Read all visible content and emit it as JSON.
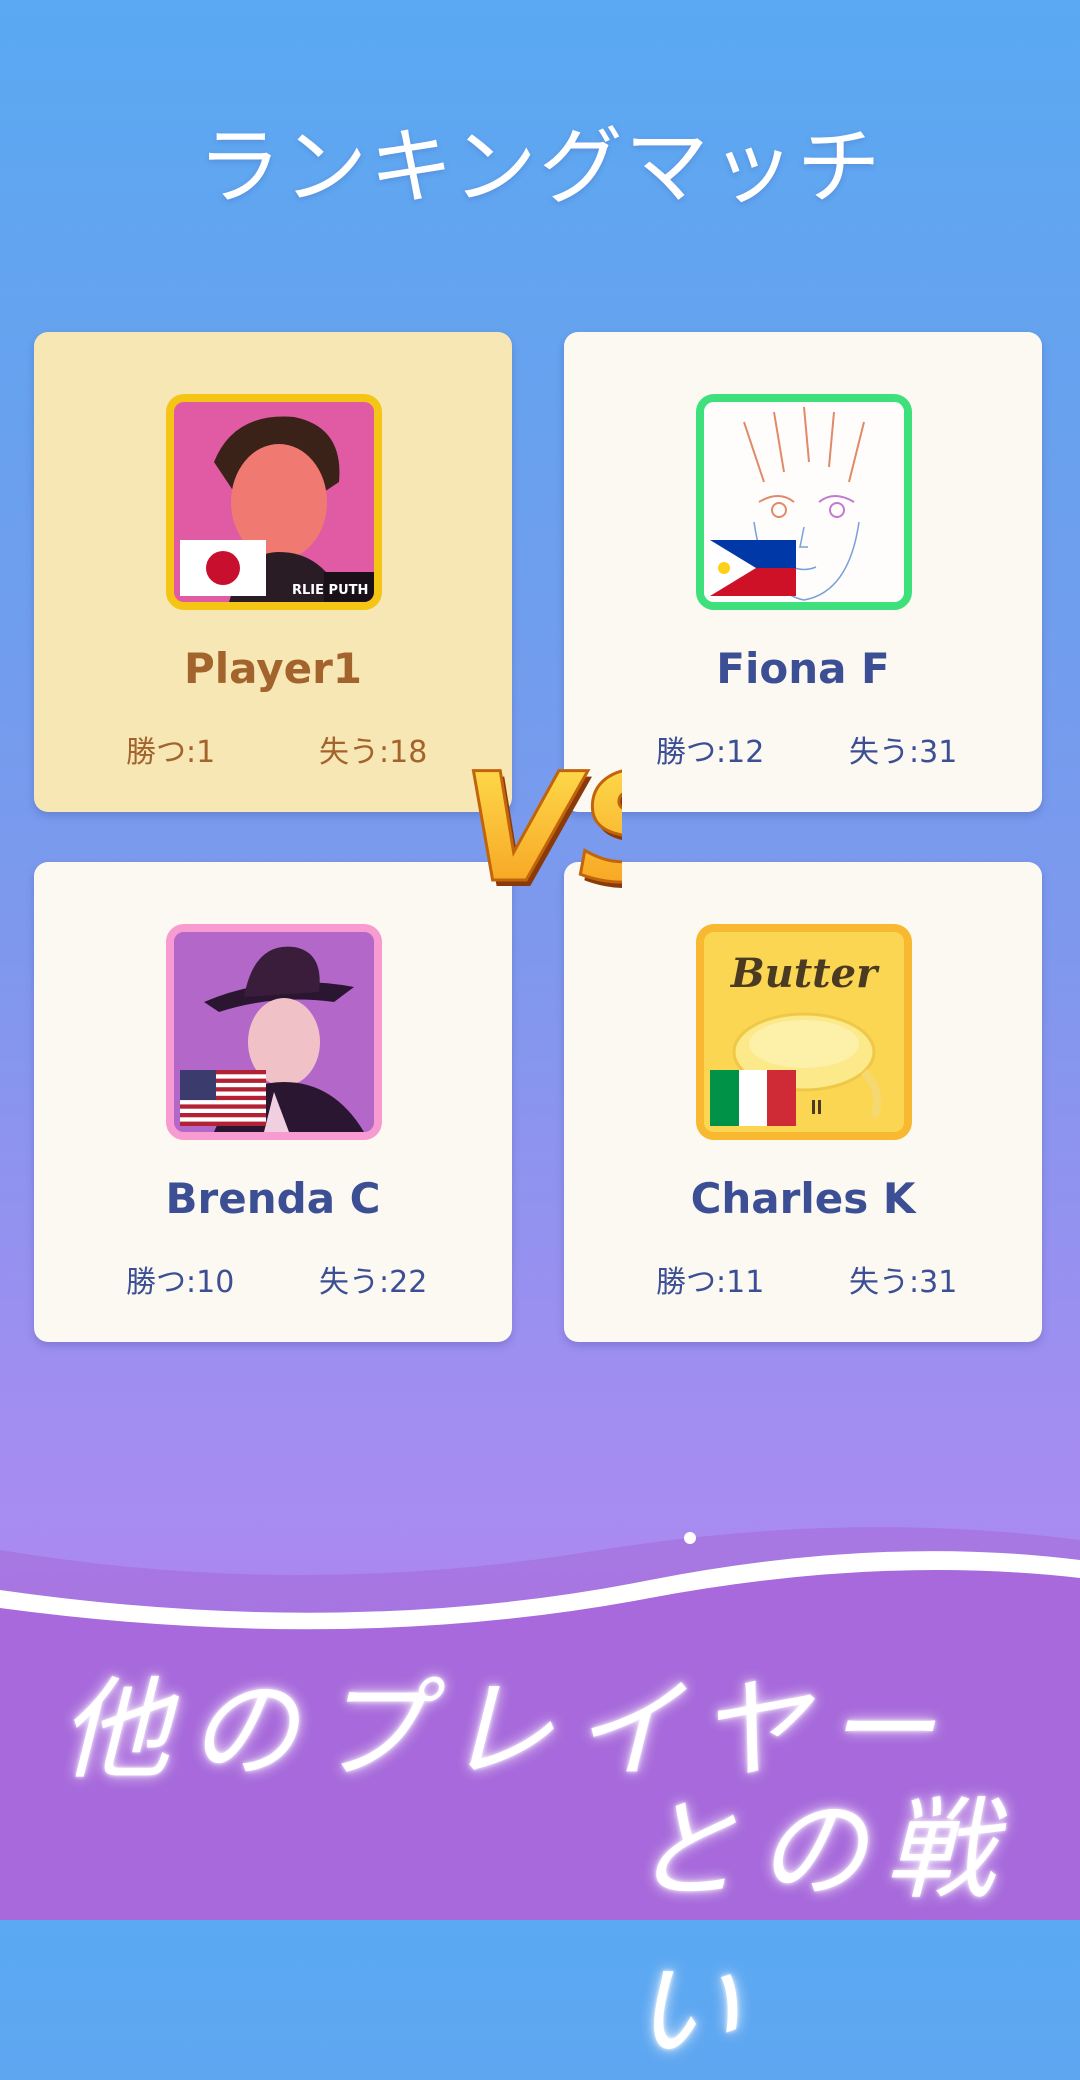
{
  "title": "ランキングマッチ",
  "players": [
    {
      "name": "Player1",
      "win_label": "勝つ:1",
      "loss_label": "失う:18",
      "flag": "japan-flag",
      "frame_color": "#f5c516",
      "highlight": true
    },
    {
      "name": "Fiona F",
      "win_label": "勝つ:12",
      "loss_label": "失う:31",
      "flag": "philippines-flag",
      "frame_color": "#3de07a",
      "highlight": false
    },
    {
      "name": "Brenda C",
      "win_label": "勝つ:10",
      "loss_label": "失う:22",
      "flag": "usa-flag",
      "frame_color": "#f79bd0",
      "highlight": false
    },
    {
      "name": "Charles K",
      "win_label": "勝つ:11",
      "loss_label": "失う:31",
      "flag": "italy-flag",
      "frame_color": "#f8b830",
      "highlight": false
    }
  ],
  "album_text": {
    "player1": "RLIE PUTH",
    "charles": "Butter"
  },
  "vs_label": "VS",
  "tagline": {
    "line1": "他のプレイヤー",
    "line2": "との戦い"
  }
}
